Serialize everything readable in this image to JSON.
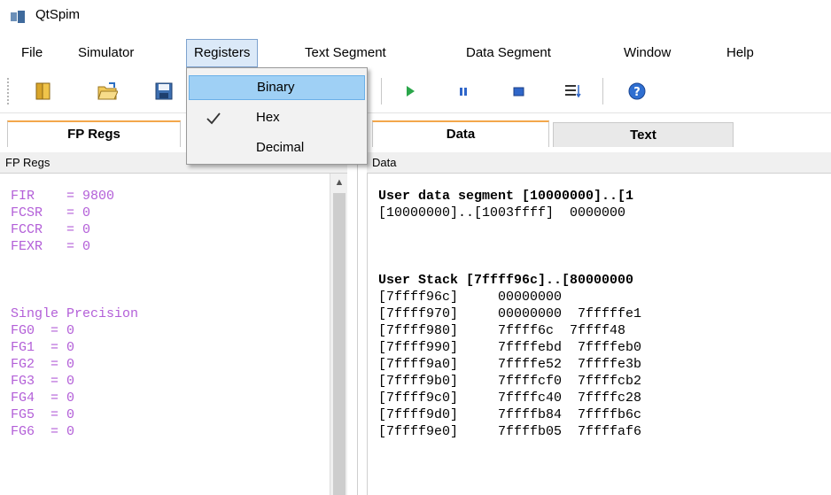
{
  "window": {
    "title": "QtSpim"
  },
  "menubar": {
    "items": [
      {
        "label": "File"
      },
      {
        "label": "Simulator"
      },
      {
        "label": "Registers"
      },
      {
        "label": "Text Segment"
      },
      {
        "label": "Data Segment"
      },
      {
        "label": "Window"
      },
      {
        "label": "Help"
      }
    ]
  },
  "registers_menu": {
    "items": [
      {
        "label": "Binary",
        "checked": false,
        "highlighted": true
      },
      {
        "label": "Hex",
        "checked": true,
        "highlighted": false
      },
      {
        "label": "Decimal",
        "checked": false,
        "highlighted": false
      }
    ]
  },
  "toolbar": {
    "icons": [
      "clear-registers-icon",
      "load-file-icon",
      "save-log-icon",
      "run-icon",
      "pause-icon",
      "stop-icon",
      "single-step-icon",
      "help-icon"
    ]
  },
  "left_tabs": {
    "fp_regs": "FP Regs"
  },
  "right_tabs": {
    "data": "Data",
    "text": "Text"
  },
  "fp_panel": {
    "header": "FP Regs",
    "lines": [
      "FIR    = 9800",
      "FCSR   = 0",
      "FCCR   = 0",
      "FEXR   = 0",
      "",
      "",
      "",
      "Single Precision",
      "FG0  = 0",
      "FG1  = 0",
      "FG2  = 0",
      "FG3  = 0",
      "FG4  = 0",
      "FG5  = 0",
      "FG6  = 0"
    ]
  },
  "data_panel": {
    "header": "Data",
    "lines": [
      "User data segment [10000000]..[1",
      "[10000000]..[1003ffff]  0000000",
      "",
      "",
      "",
      "User Stack [7ffff96c]..[80000000",
      "[7ffff96c]     00000000",
      "[7ffff970]     00000000  7fffffe1",
      "[7ffff980]     7ffff6c  7ffff48",
      "[7ffff990]     7ffffebd  7ffffeb0",
      "[7ffff9a0]     7ffffe52  7ffffe3b",
      "[7ffff9b0]     7ffffcf0  7ffffcb2",
      "[7ffff9c0]     7ffffc40  7ffffc28",
      "[7ffff9d0]     7ffffb84  7ffffb6c",
      "[7ffff9e0]     7ffffb05  7ffffaf6"
    ]
  },
  "colors": {
    "fp_text": "#b35fd8",
    "menu_highlight": "#9fd0f5",
    "active_tab_accent": "#f3a74b"
  }
}
